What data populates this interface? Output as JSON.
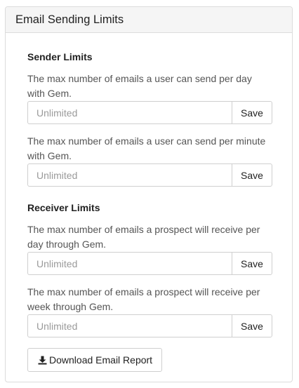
{
  "panel": {
    "title": "Email Sending Limits"
  },
  "sender": {
    "heading": "Sender Limits",
    "per_day": {
      "description": "The max number of emails a user can send per day with Gem.",
      "placeholder": "Unlimited",
      "value": "",
      "save_label": "Save"
    },
    "per_minute": {
      "description": "The max number of emails a user can send per minute with Gem.",
      "placeholder": "Unlimited",
      "value": "",
      "save_label": "Save"
    }
  },
  "receiver": {
    "heading": "Receiver Limits",
    "per_day": {
      "description": "The max number of emails a prospect will receive per day through Gem.",
      "placeholder": "Unlimited",
      "value": "",
      "save_label": "Save"
    },
    "per_week": {
      "description": "The max number of emails a prospect will receive per week through Gem.",
      "placeholder": "Unlimited",
      "value": "",
      "save_label": "Save"
    }
  },
  "report_button": {
    "label": "Download Email Report",
    "icon": "download-icon"
  }
}
